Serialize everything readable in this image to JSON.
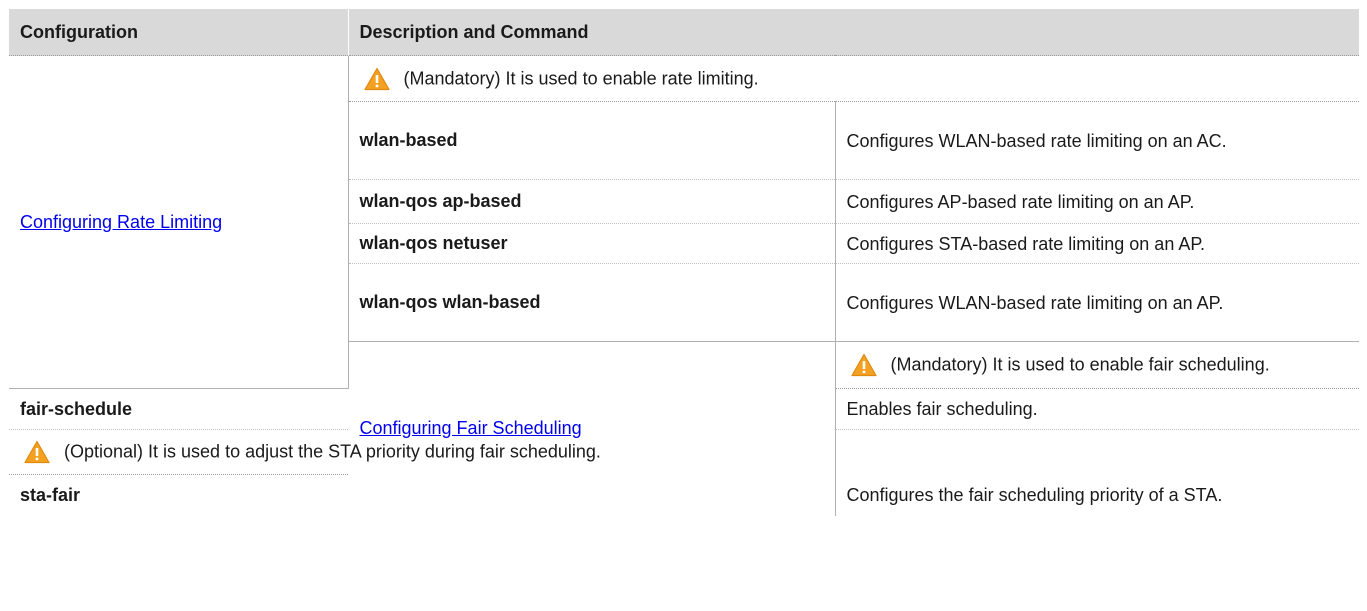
{
  "header": {
    "col1": "Configuration",
    "col2": "Description and Command"
  },
  "sections": [
    {
      "link": "Configuring Rate Limiting",
      "note": "(Mandatory) It is used to enable rate limiting.",
      "commands": [
        {
          "cmd": "wlan-based",
          "desc": "Configures WLAN-based rate limiting on an AC."
        },
        {
          "cmd": "wlan-qos ap-based",
          "desc": "Configures AP-based rate limiting on an AP."
        },
        {
          "cmd": "wlan-qos netuser",
          "desc": "Configures STA-based rate limiting on an AP."
        },
        {
          "cmd": "wlan-qos wlan-based",
          "desc": "Configures WLAN-based rate limiting on an AP."
        }
      ]
    },
    {
      "link": "Configuring Fair Scheduling",
      "note": "(Mandatory) It is used to enable fair scheduling.",
      "commands": [
        {
          "cmd": "fair-schedule",
          "desc": "Enables fair scheduling."
        }
      ],
      "note2": "(Optional) It is used to adjust the STA priority during fair scheduling.",
      "commands2": [
        {
          "cmd": "sta-fair",
          "desc": "Configures the fair scheduling priority of a STA."
        }
      ]
    }
  ],
  "icons": {
    "note_icon": "warning-triangle-icon",
    "warning_color": "#f4a020"
  }
}
